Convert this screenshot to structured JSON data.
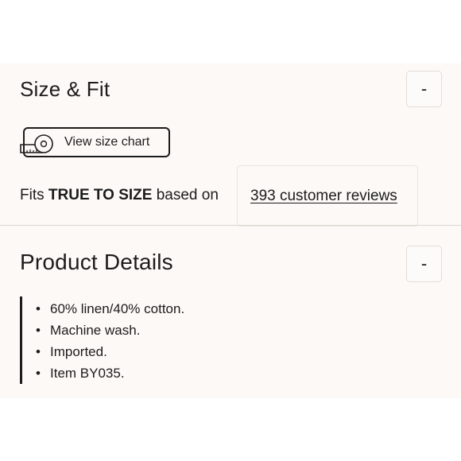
{
  "size_fit": {
    "title": "Size & Fit",
    "toggle_label": "-",
    "size_chart_label": "View size chart",
    "size_chart_icon": "measuring-tape-icon",
    "fit_prefix": "Fits",
    "fit_emphasis": "TRUE TO SIZE",
    "fit_suffix": "based on",
    "reviews_link": "393 customer reviews"
  },
  "product_details": {
    "title": "Product Details",
    "toggle_label": "-",
    "bullet": "•",
    "items": [
      "60% linen/40% cotton.",
      "Machine wash.",
      "Imported.",
      "Item BY035."
    ]
  },
  "colors": {
    "panel_background": "#fcf9f6",
    "text": "#1c1c1c",
    "divider": "#dcd6d0"
  }
}
